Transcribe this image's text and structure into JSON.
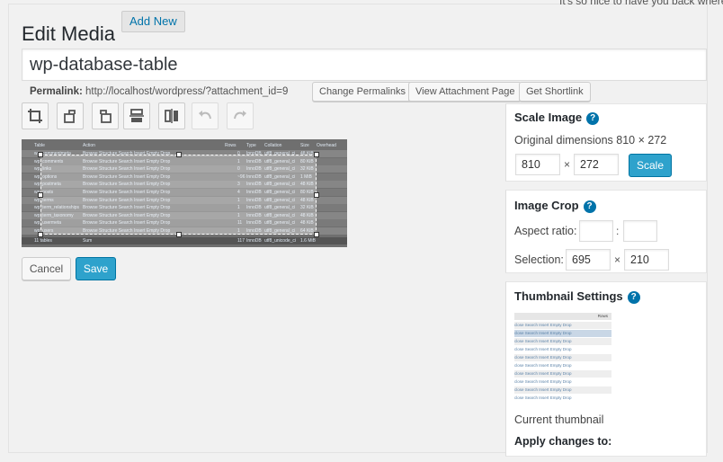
{
  "header": {
    "welcome_text": "It's so nice to have you back where y",
    "title": "Edit Media",
    "add_new": "Add New"
  },
  "media": {
    "title_value": "wp-database-table",
    "permalink_label": "Permalink:",
    "permalink_url": "http://localhost/wordpress/?attachment_id=9",
    "buttons": {
      "change_permalinks": "Change Permalinks",
      "view_attachment": "View Attachment Page",
      "get_shortlink": "Get Shortlink"
    }
  },
  "toolbar": {
    "tools": [
      "crop-icon",
      "rotate-left-icon",
      "rotate-right-icon",
      "flip-vertical-icon",
      "flip-horizontal-icon",
      "undo-icon",
      "redo-icon"
    ]
  },
  "preview": {
    "header": [
      "Table",
      "Action",
      "Rows",
      "Type",
      "Collation",
      "Size",
      "Overhead"
    ],
    "rows": [
      {
        "table": "wp_commentmeta",
        "action": "Browse  Structure  Search  Insert  Empty  Drop",
        "rows": "0",
        "type": "InnoDB",
        "collation": "utf8_general_ci",
        "size": "48 KiB"
      },
      {
        "table": "wp_comments",
        "action": "Browse  Structure  Search  Insert  Empty  Drop",
        "rows": "1",
        "type": "InnoDB",
        "collation": "utf8_general_ci",
        "size": "80 KiB"
      },
      {
        "table": "wp_links",
        "action": "Browse  Structure  Search  Insert  Empty  Drop",
        "rows": "0",
        "type": "InnoDB",
        "collation": "utf8_general_ci",
        "size": "32 KiB"
      },
      {
        "table": "wp_options",
        "action": "Browse  Structure  Search  Insert  Empty  Drop",
        "rows": "~96",
        "type": "InnoDB",
        "collation": "utf8_general_ci",
        "size": "1 MiB"
      },
      {
        "table": "wp_postmeta",
        "action": "Browse  Structure  Search  Insert  Empty  Drop",
        "rows": "3",
        "type": "InnoDB",
        "collation": "utf8_general_ci",
        "size": "48 KiB"
      },
      {
        "table": "wp_posts",
        "action": "Browse  Structure  Search  Insert  Empty  Drop",
        "rows": "4",
        "type": "InnoDB",
        "collation": "utf8_general_ci",
        "size": "80 KiB"
      },
      {
        "table": "wp_terms",
        "action": "Browse  Structure  Search  Insert  Empty  Drop",
        "rows": "1",
        "type": "InnoDB",
        "collation": "utf8_general_ci",
        "size": "48 KiB"
      },
      {
        "table": "wp_term_relationships",
        "action": "Browse  Structure  Search  Insert  Empty  Drop",
        "rows": "1",
        "type": "InnoDB",
        "collation": "utf8_general_ci",
        "size": "32 KiB"
      },
      {
        "table": "wp_term_taxonomy",
        "action": "Browse  Structure  Search  Insert  Empty  Drop",
        "rows": "1",
        "type": "InnoDB",
        "collation": "utf8_general_ci",
        "size": "48 KiB"
      },
      {
        "table": "wp_usermeta",
        "action": "Browse  Structure  Search  Insert  Empty  Drop",
        "rows": "11",
        "type": "InnoDB",
        "collation": "utf8_general_ci",
        "size": "48 KiB"
      },
      {
        "table": "wp_users",
        "action": "Browse  Structure  Search  Insert  Empty  Drop",
        "rows": "1",
        "type": "InnoDB",
        "collation": "utf8_general_ci",
        "size": "64 KiB"
      }
    ],
    "footer": {
      "table": "11 tables",
      "action": "Sum",
      "rows": "117",
      "type": "InnoDB",
      "collation": "utf8_unicode_ci",
      "size": "1.6 MiB"
    }
  },
  "actions": {
    "cancel": "Cancel",
    "save": "Save"
  },
  "scale_image": {
    "title": "Scale Image",
    "original_label": "Original dimensions 810 × 272",
    "width": "810",
    "height": "272",
    "times": "×",
    "button": "Scale"
  },
  "image_crop": {
    "title": "Image Crop",
    "aspect_label": "Aspect ratio:",
    "aspect_w": "",
    "aspect_h": "",
    "colon": ":",
    "selection_label": "Selection:",
    "sel_w": "695",
    "sel_h": "210",
    "times": "×"
  },
  "thumbnail": {
    "title": "Thumbnail Settings",
    "preview_header": "Rows",
    "rows": [
      "close  Search  Insert  Empty  Drop",
      "close  Search  Insert  Empty  Drop",
      "close  Search  Insert  Empty  Drop",
      "close  Search  Insert  Empty  Drop",
      "close  Search  Insert  Empty  Drop",
      "close  Search  Insert  Empty  Drop",
      "close  Search  Insert  Empty  Drop",
      "close  Search  Insert  Empty  Drop",
      "close  Search  Insert  Empty  Drop",
      "close  Search  Insert  Empty  Drop"
    ],
    "current_label": "Current thumbnail",
    "apply_label": "Apply changes to:"
  },
  "colors": {
    "primary": "#2ea2cc",
    "link": "#0073aa",
    "background": "#f1f1f1"
  }
}
